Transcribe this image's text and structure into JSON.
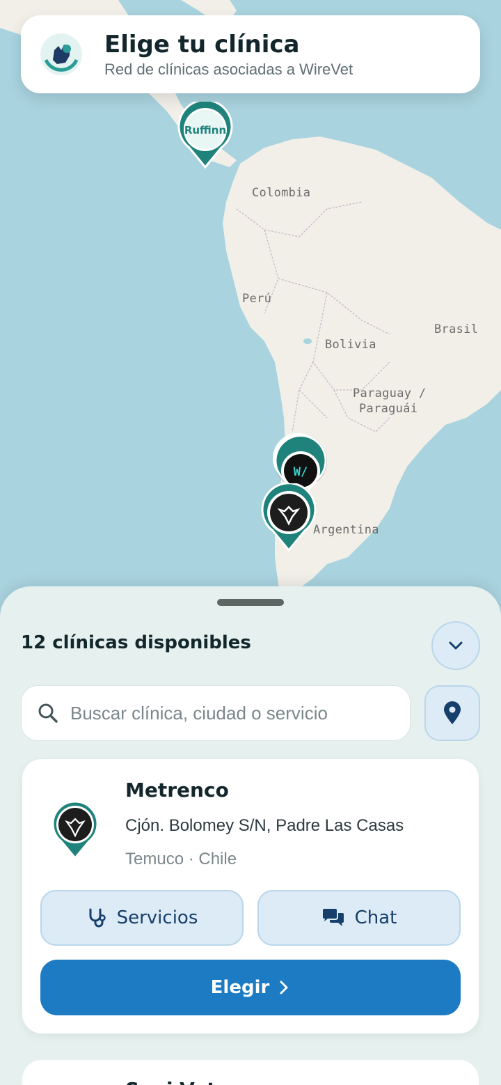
{
  "header": {
    "title": "Elige tu clínica",
    "subtitle": "Red de clínicas asociadas a WireVet"
  },
  "map": {
    "labels": {
      "colombia": "Colombia",
      "peru": "Perú",
      "brasil": "Brasil",
      "bolivia": "Bolivia",
      "paraguay_1": "Paraguay /",
      "paraguay_2": "Paraguái",
      "argentina": "Argentina"
    },
    "pins": [
      {
        "name": "Ruffinn",
        "logo_text": "Ruffinn"
      },
      {
        "name": "WireVet",
        "logo_text": "W/"
      },
      {
        "name": "Metrenco"
      }
    ]
  },
  "sheet": {
    "count_label": "12 clínicas disponibles",
    "search_placeholder": "Buscar clínica, ciudad o servicio"
  },
  "clinic": {
    "name": "Metrenco",
    "address": "Cjón. Bolomey S/N, Padre Las Casas",
    "city": "Temuco · Chile",
    "services_label": "Servicios",
    "chat_label": "Chat",
    "choose_label": "Elegir"
  },
  "next_clinic": {
    "name": "Sani-Vet"
  },
  "colors": {
    "primary": "#1c7bc3",
    "teal": "#1f837c",
    "sea": "#a9d3df",
    "land": "#f1efe8",
    "sheet_bg": "#e6f1ef"
  }
}
